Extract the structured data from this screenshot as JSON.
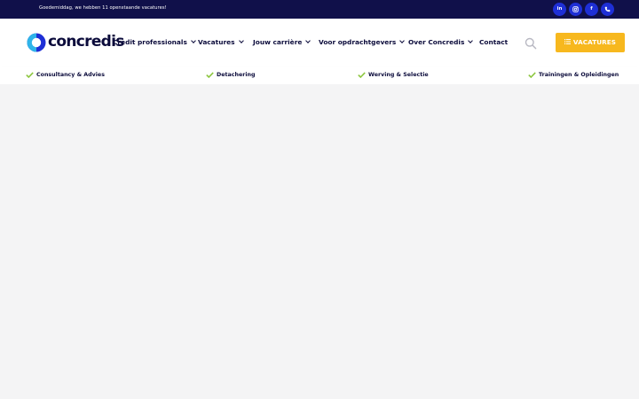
{
  "topbar": {
    "greeting": "Goedemiddag, we hebben 11 openstaande vacatures!",
    "social": [
      {
        "icon": "linkedin-icon",
        "label": "in"
      },
      {
        "icon": "instagram-icon",
        "label": ""
      },
      {
        "icon": "facebook-icon",
        "label": "f"
      },
      {
        "icon": "phone-icon",
        "label": ""
      }
    ]
  },
  "header": {
    "logo_text": "concredis",
    "nav": [
      {
        "label": "Credit professionals",
        "has_dropdown": true
      },
      {
        "label": "Vacatures",
        "has_dropdown": true
      },
      {
        "label": "Jouw carrière",
        "has_dropdown": true
      },
      {
        "label": "Voor opdrachtgevers",
        "has_dropdown": true
      },
      {
        "label": "Over Concredis",
        "has_dropdown": true
      },
      {
        "label": "Contact",
        "has_dropdown": false
      }
    ],
    "search_icon": "search-icon",
    "cta_label": "VACATURES",
    "cta_icon": "list-icon"
  },
  "usps": [
    {
      "label": "Consultancy & Advies",
      "icon": "checkmark-icon"
    },
    {
      "label": "Detachering",
      "icon": "checkmark-icon"
    },
    {
      "label": "Werving & Selectie",
      "icon": "checkmark-icon"
    },
    {
      "label": "Trainingen & Opleidingen",
      "icon": "checkmark-icon"
    }
  ],
  "colors": {
    "topbar_bg": "#10104a",
    "brand_navy": "#0b0b3b",
    "social_blue": "#1e2fd6",
    "cta_yellow": "#f7b81e",
    "check_green": "#8cc63f",
    "page_bg": "#f4f4f5"
  }
}
